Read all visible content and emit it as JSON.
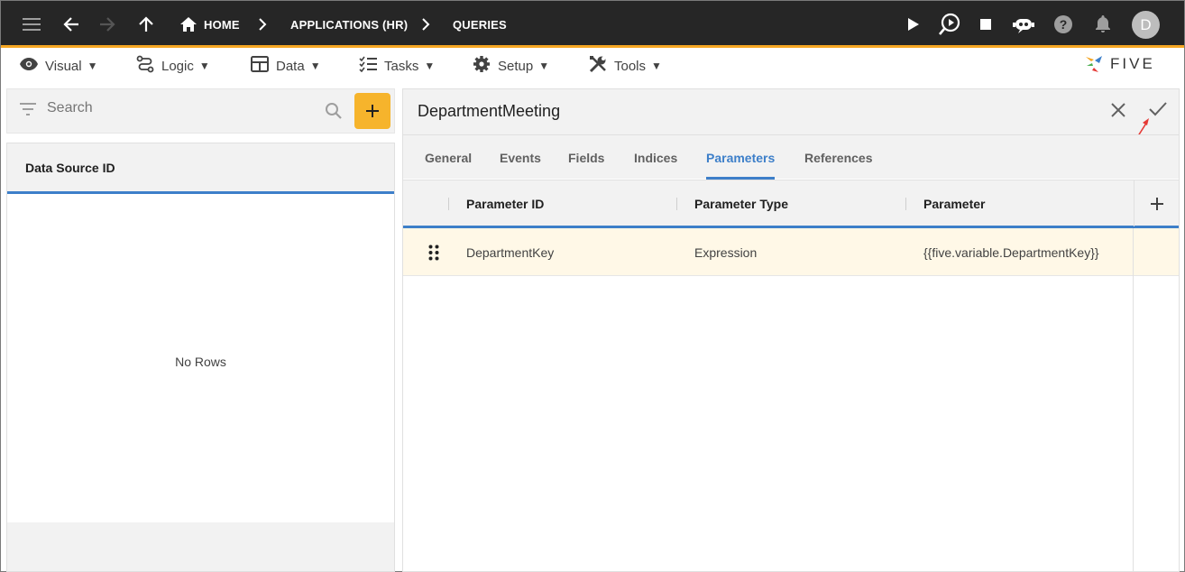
{
  "topbar": {
    "breadcrumbs": [
      "HOME",
      "APPLICATIONS (HR)",
      "QUERIES"
    ],
    "avatar_initial": "D",
    "accent_color": "#f5a623"
  },
  "menubar": {
    "items": [
      {
        "label": "Visual",
        "icon": "eye-icon"
      },
      {
        "label": "Logic",
        "icon": "flow-icon"
      },
      {
        "label": "Data",
        "icon": "table-icon"
      },
      {
        "label": "Tasks",
        "icon": "checklist-icon"
      },
      {
        "label": "Setup",
        "icon": "gear-icon"
      },
      {
        "label": "Tools",
        "icon": "tools-icon"
      }
    ],
    "caret": "▼",
    "logo_text": "FIVE"
  },
  "left": {
    "search_placeholder": "Search",
    "column_header": "Data Source ID",
    "empty_text": "No Rows"
  },
  "right": {
    "title": "DepartmentMeeting",
    "tabs": [
      "General",
      "Events",
      "Fields",
      "Indices",
      "Parameters",
      "References"
    ],
    "active_tab": "Parameters",
    "columns": [
      "Parameter ID",
      "Parameter Type",
      "Parameter"
    ],
    "rows": [
      {
        "parameter_id": "DepartmentKey",
        "parameter_type": "Expression",
        "parameter": "{{five.variable.DepartmentKey}}"
      }
    ]
  },
  "colors": {
    "active_blue": "#3d7fc9",
    "add_button": "#f6b42c",
    "selected_row": "#fff8e7"
  }
}
